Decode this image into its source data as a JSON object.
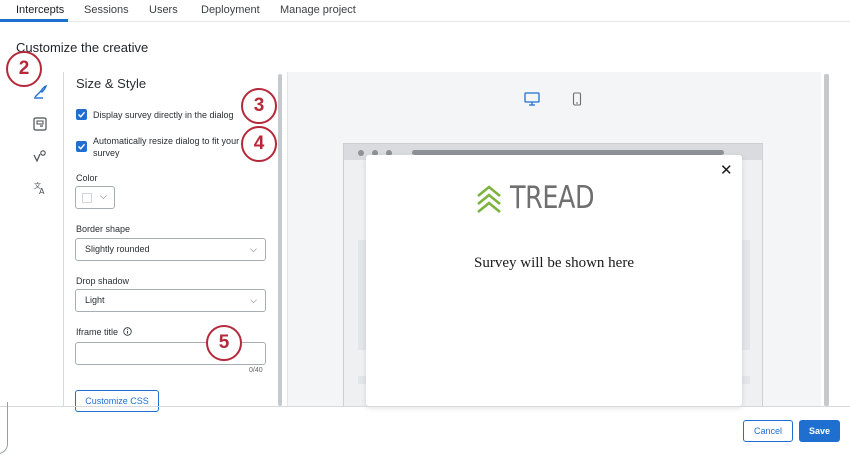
{
  "tabs": [
    {
      "label": "Intercepts"
    },
    {
      "label": "Sessions"
    },
    {
      "label": "Users"
    },
    {
      "label": "Deployment"
    },
    {
      "label": "Manage project"
    }
  ],
  "page_title": "Customize the creative",
  "step_markers": [
    "2",
    "3",
    "4",
    "5"
  ],
  "rail": {
    "icons": [
      "paintbrush-icon",
      "image-layout-icon",
      "variable-icon",
      "translate-icon"
    ]
  },
  "panel": {
    "title": "Size & Style",
    "display_checkbox_label": "Display survey directly in the dialog",
    "resize_checkbox_label": "Automatically resize dialog to fit your survey",
    "color_label": "Color",
    "border_shape_label": "Border shape",
    "border_shape_value": "Slightly rounded",
    "drop_shadow_label": "Drop shadow",
    "drop_shadow_value": "Light",
    "iframe_title_label": "Iframe title",
    "iframe_title_value": "",
    "iframe_counter": "0/40",
    "customize_css_label": "Customize CSS"
  },
  "preview": {
    "device_icons": [
      "desktop-icon",
      "mobile-icon"
    ],
    "close_glyph": "✕",
    "logo_text": "TREAD",
    "message": "Survey will be shown here"
  },
  "footer": {
    "cancel_label": "Cancel",
    "save_label": "Save"
  },
  "colors": {
    "accent": "#1f6fd1",
    "marker": "#b5293a",
    "logo_green": "#7bb33e"
  }
}
